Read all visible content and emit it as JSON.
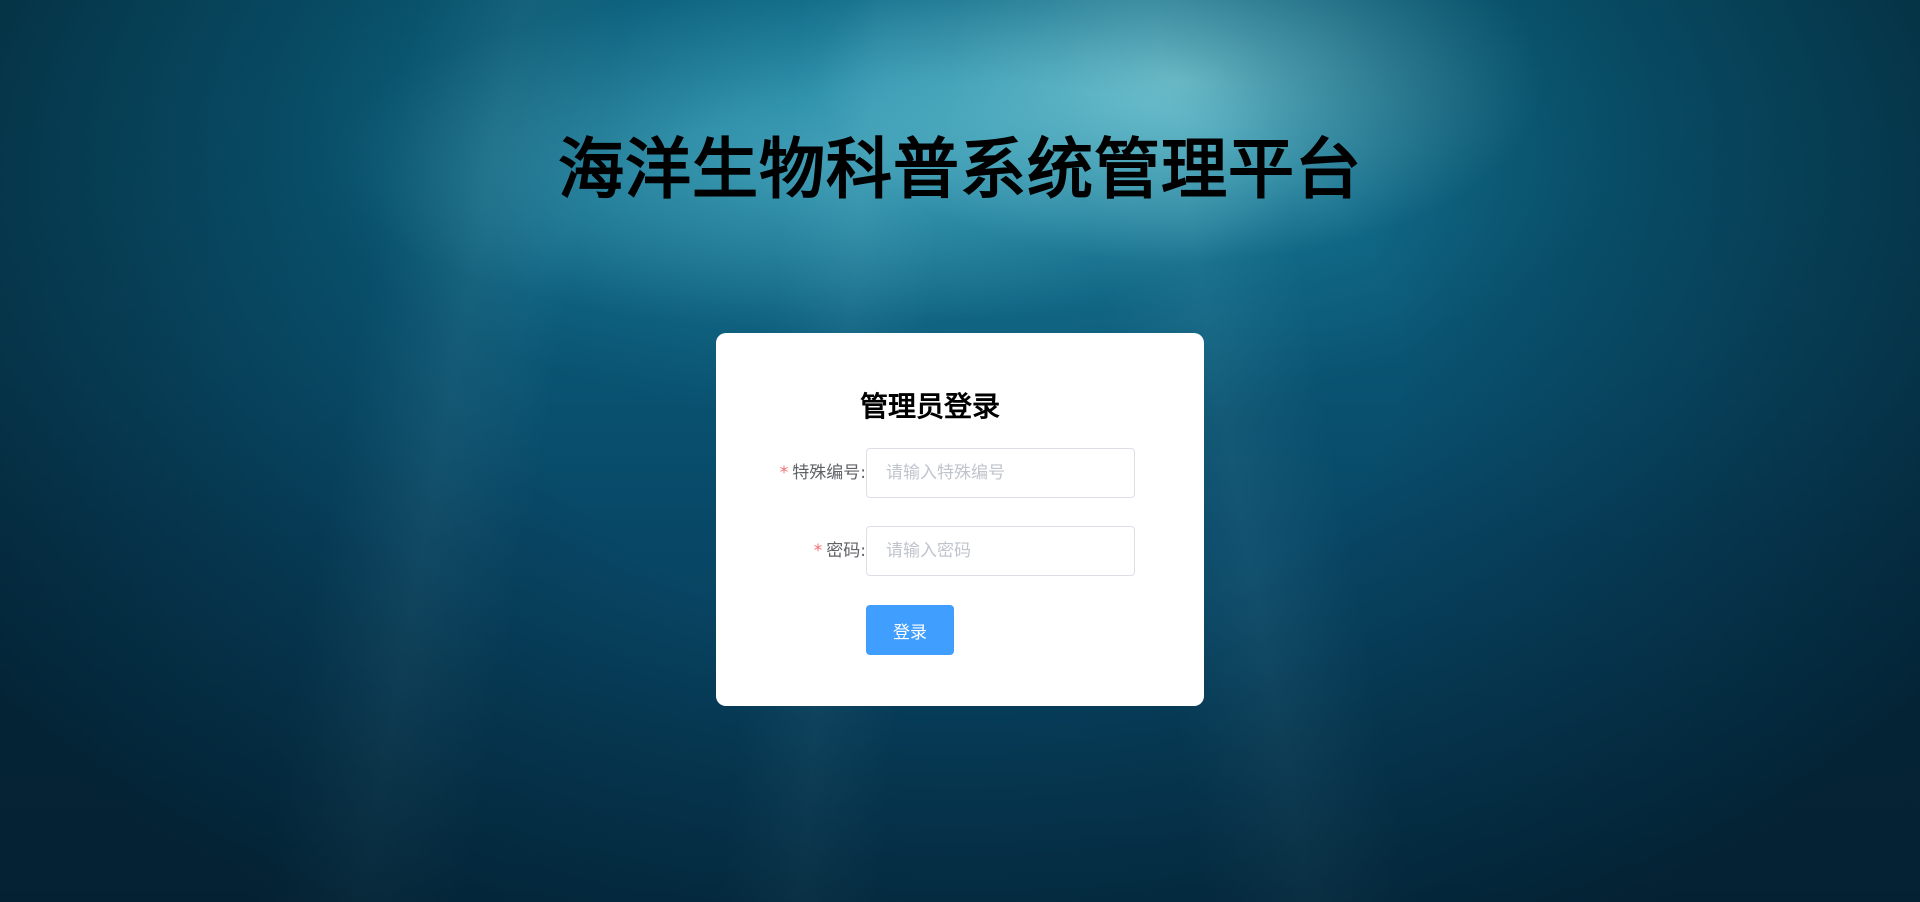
{
  "header": {
    "title": "海洋生物科普系统管理平台"
  },
  "login": {
    "title": "管理员登录",
    "fields": [
      {
        "required_mark": "*",
        "label": "特殊编号:",
        "placeholder": "请输入特殊编号",
        "value": ""
      },
      {
        "required_mark": "*",
        "label": "密码:",
        "placeholder": "请输入密码",
        "value": ""
      }
    ],
    "submit_label": "登录"
  },
  "colors": {
    "primary_button": "#409eff",
    "required_mark": "#f56c6c",
    "card_background": "#ffffff",
    "ocean_background": "#0a5a78"
  }
}
